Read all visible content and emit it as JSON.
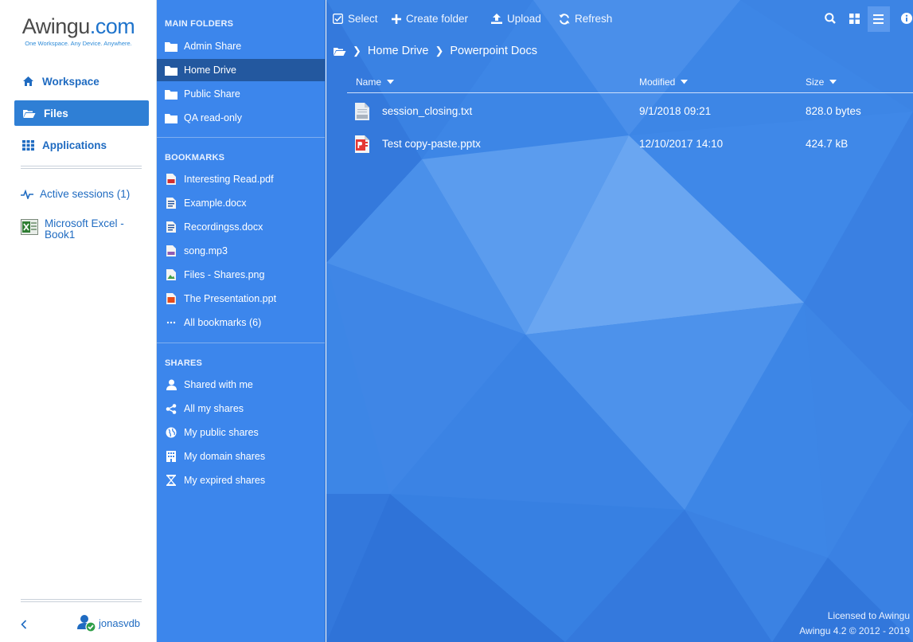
{
  "brand": {
    "logo_main": "Awingu",
    "logo_dot": ".com",
    "tagline": "One Workspace. Any Device. Anywhere."
  },
  "nav": {
    "workspace": "Workspace",
    "files": "Files",
    "applications": "Applications"
  },
  "sessions": {
    "active_label": "Active sessions (1)",
    "app_session": "Microsoft Excel - Book1"
  },
  "user": {
    "name": "jonasvdb",
    "status": "online"
  },
  "folders": {
    "main_title": "MAIN FOLDERS",
    "main": [
      {
        "label": "Admin Share",
        "icon": "folder-icon"
      },
      {
        "label": "Home Drive",
        "icon": "folder-icon",
        "selected": true
      },
      {
        "label": "Public Share",
        "icon": "folder-icon"
      },
      {
        "label": "QA read-only",
        "icon": "folder-icon"
      }
    ],
    "bookmarks_title": "BOOKMARKS",
    "bookmarks": [
      {
        "label": "Interesting Read.pdf",
        "icon": "pdf-file-icon"
      },
      {
        "label": "Example.docx",
        "icon": "doc-file-icon"
      },
      {
        "label": "Recordingss.docx",
        "icon": "doc-file-icon"
      },
      {
        "label": "song.mp3",
        "icon": "audio-file-icon"
      },
      {
        "label": "Files - Shares.png",
        "icon": "image-file-icon"
      },
      {
        "label": "The Presentation.ppt",
        "icon": "ppt-file-icon"
      },
      {
        "label": "All bookmarks (6)",
        "icon": "ellipsis-icon"
      }
    ],
    "shares_title": "SHARES",
    "shares": [
      {
        "label": "Shared with me",
        "icon": "user-icon"
      },
      {
        "label": "All my shares",
        "icon": "share-icon"
      },
      {
        "label": "My public shares",
        "icon": "globe-icon"
      },
      {
        "label": "My domain shares",
        "icon": "building-icon"
      },
      {
        "label": "My expired shares",
        "icon": "hourglass-icon"
      }
    ]
  },
  "toolbar": {
    "select": "Select",
    "create_folder": "Create folder",
    "upload": "Upload",
    "refresh": "Refresh"
  },
  "breadcrumb": {
    "items": [
      "Home Drive",
      "Powerpoint Docs"
    ]
  },
  "table": {
    "headers": {
      "name": "Name",
      "modified": "Modified",
      "size": "Size"
    },
    "rows": [
      {
        "name": "session_closing.txt",
        "modified": "9/1/2018 09:21",
        "size": "828.0 bytes",
        "icon": "txt-file-icon"
      },
      {
        "name": "Test copy-paste.pptx",
        "modified": "12/10/2017 14:10",
        "size": "424.7 kB",
        "icon": "pptx-file-icon"
      }
    ]
  },
  "footer": {
    "licensed": "Licensed to Awingu",
    "version": "Awingu 4.2 © 2012 - 2019"
  },
  "colors": {
    "accent": "#2f7fd5",
    "panel": "#3c86ec",
    "selected": "#23589f",
    "main_bg": "#3d86e6"
  }
}
